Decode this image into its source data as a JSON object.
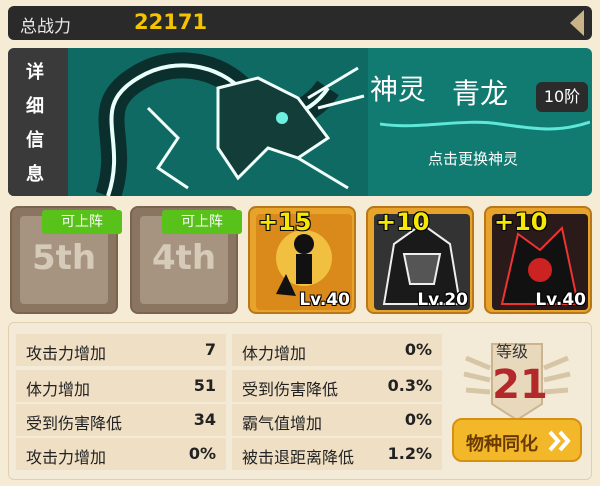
{
  "topbar": {
    "label": "总战力",
    "power": "22171"
  },
  "banner": {
    "side_chars": [
      "详",
      "细",
      "信",
      "息"
    ],
    "name_prefix": "神灵",
    "name": "青龙",
    "rank": "10阶",
    "hint": "点击更换神灵"
  },
  "slots": [
    {
      "label": "5th",
      "tag": "可上阵"
    },
    {
      "label": "4th",
      "tag": "可上阵"
    }
  ],
  "heroes": [
    {
      "plus": "+15",
      "level": "Lv.40"
    },
    {
      "plus": "+10",
      "level": "Lv.20"
    },
    {
      "plus": "+10",
      "level": "Lv.40"
    }
  ],
  "stats_left": [
    {
      "k": "攻击力增加",
      "v": "7"
    },
    {
      "k": "体力增加",
      "v": "51"
    },
    {
      "k": "受到伤害降低",
      "v": "34"
    },
    {
      "k": "攻击力增加",
      "v": "0%"
    }
  ],
  "stats_right": [
    {
      "k": "体力增加",
      "v": "0%"
    },
    {
      "k": "受到伤害降低",
      "v": "0.3%"
    },
    {
      "k": "霸气值增加",
      "v": "0%"
    },
    {
      "k": "被击退距离降低",
      "v": "1.2%"
    }
  ],
  "level": {
    "label": "等级",
    "value": "21"
  },
  "sync_button": {
    "label": "物种同化"
  },
  "colors": {
    "accent": "#f5c400",
    "banner": "#117a71",
    "level": "#b3282a",
    "button": "#f3b82a"
  }
}
